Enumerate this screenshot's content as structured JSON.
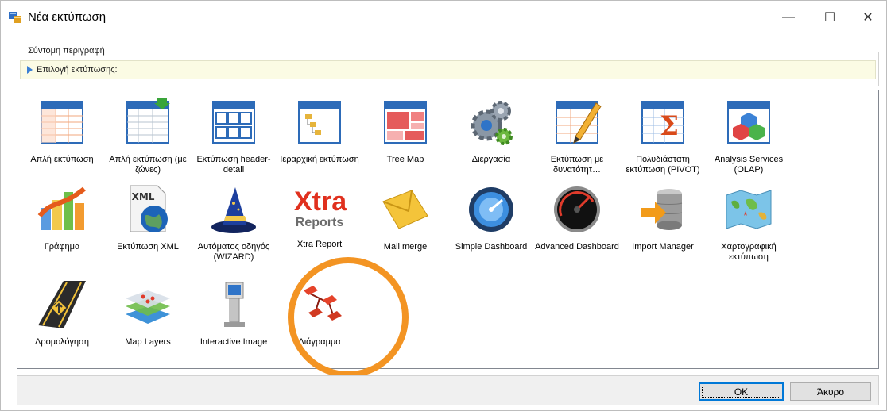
{
  "window": {
    "title": "Νέα εκτύπωση",
    "controls": {
      "minimize": "—",
      "maximize": "☐",
      "close": "✕"
    }
  },
  "description": {
    "group_label": "Σύντομη περιγραφή",
    "info_text": "Επιλογή εκτύπωσης:"
  },
  "items": [
    {
      "label": "Απλή εκτύπωση",
      "icon": "simple-print-icon"
    },
    {
      "label": "Απλή εκτύπωση (με ζώνες)",
      "icon": "banded-print-icon"
    },
    {
      "label": "Εκτύπωση header-detail",
      "icon": "header-detail-icon"
    },
    {
      "label": "Ιεραρχική εκτύπωση",
      "icon": "hierarchy-icon"
    },
    {
      "label": "Tree Map",
      "icon": "tree-map-icon"
    },
    {
      "label": "Διεργασία",
      "icon": "gears-icon"
    },
    {
      "label": "Εκτύπωση με δυνατότητ…",
      "icon": "edit-print-icon"
    },
    {
      "label": "Πολυδιάστατη εκτύπωση (PIVOT)",
      "icon": "pivot-icon"
    },
    {
      "label": "Analysis Services (OLAP)",
      "icon": "olap-cubes-icon"
    },
    {
      "label": "Γράφημα",
      "icon": "chart-icon"
    },
    {
      "label": "Εκτύπωση XML",
      "icon": "xml-icon"
    },
    {
      "label": "Αυτόματος οδηγός (WIZARD)",
      "icon": "wizard-hat-icon"
    },
    {
      "label": "Xtra Report",
      "icon": "xtra-reports-icon",
      "logo_top": "Xtra",
      "logo_bottom": "Reports"
    },
    {
      "label": "Mail merge",
      "icon": "envelope-icon"
    },
    {
      "label": "Simple Dashboard",
      "icon": "gauge-blue-icon"
    },
    {
      "label": "Advanced Dashboard",
      "icon": "gauge-dark-icon"
    },
    {
      "label": "Import Manager",
      "icon": "database-import-icon"
    },
    {
      "label": "Χαρτογραφική εκτύπωση",
      "icon": "world-map-icon"
    },
    {
      "label": "Δρομολόγηση",
      "icon": "road-icon"
    },
    {
      "label": "Map Layers",
      "icon": "map-layers-icon"
    },
    {
      "label": "Interactive Image",
      "icon": "kiosk-icon"
    },
    {
      "label": "Διάγραμμα",
      "icon": "diagram-icon"
    }
  ],
  "buttons": {
    "ok": "OK",
    "cancel": "Άκυρο"
  },
  "colors": {
    "highlight": "#f39423",
    "accent": "#0078d7",
    "info_bg": "#fbfbe4"
  }
}
